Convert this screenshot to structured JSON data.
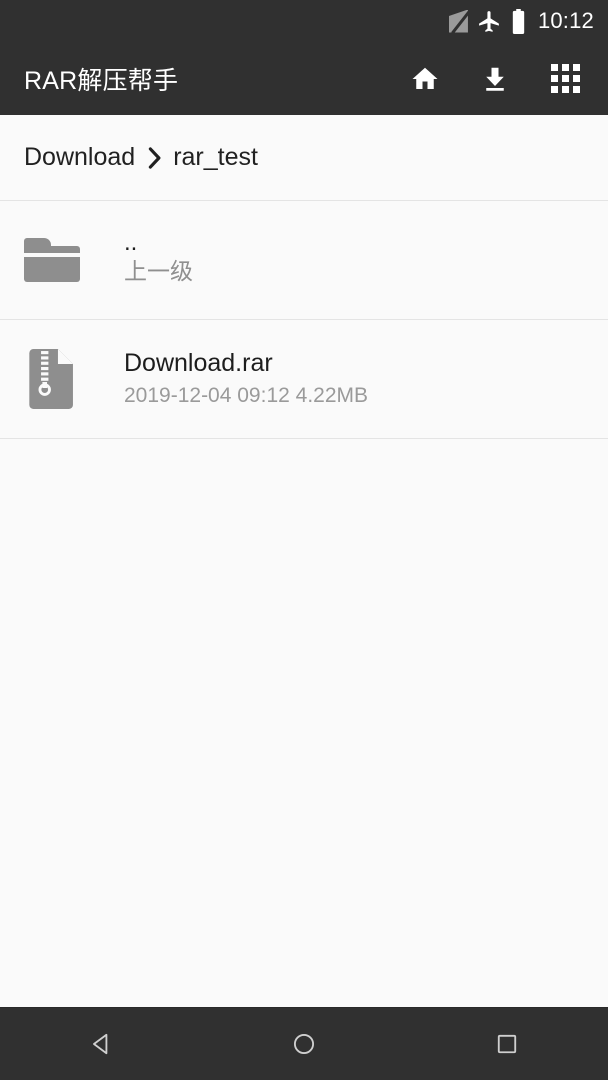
{
  "status_bar": {
    "icons": [
      "no-sim-icon",
      "airplane-mode-icon",
      "battery-icon"
    ],
    "time": "10:12",
    "background_color": "#303030",
    "foreground_color": "#ffffff"
  },
  "app_bar": {
    "title": "RAR解压帮手",
    "background_color": "#303030",
    "actions": [
      {
        "name": "home-button",
        "icon": "home-icon"
      },
      {
        "name": "downloads-button",
        "icon": "download-icon"
      },
      {
        "name": "apps-grid-button",
        "icon": "grid-icon"
      }
    ]
  },
  "breadcrumb": {
    "separator": "›",
    "items": [
      {
        "label": "Download"
      },
      {
        "label": "rar_test"
      }
    ]
  },
  "file_list": {
    "rows": [
      {
        "icon": "folder-icon",
        "title": "..",
        "subtitle": "上一级",
        "type": "parent-directory"
      },
      {
        "icon": "zip-file-icon",
        "title": "Download.rar",
        "subtitle": "2019-12-04 09:12  4.22MB",
        "type": "archive-file"
      }
    ]
  },
  "nav_bar": {
    "buttons": [
      {
        "name": "back-button",
        "icon": "back-triangle-icon"
      },
      {
        "name": "home-button",
        "icon": "home-circle-icon"
      },
      {
        "name": "recents-button",
        "icon": "recents-square-icon"
      }
    ],
    "background_color": "#303030"
  },
  "theme": {
    "toolbar_dark": "#303030",
    "content_background": "#fafafa",
    "divider": "#e4e4e4",
    "primary_text": "#1d1d1d",
    "secondary_text": "#9a9a9a",
    "icon_gray": "#8e8e8e"
  }
}
